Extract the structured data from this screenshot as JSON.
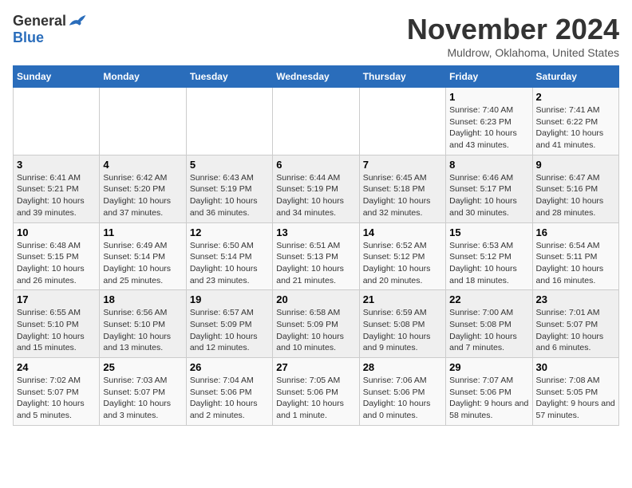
{
  "header": {
    "logo_general": "General",
    "logo_blue": "Blue",
    "month_title": "November 2024",
    "location": "Muldrow, Oklahoma, United States"
  },
  "weekdays": [
    "Sunday",
    "Monday",
    "Tuesday",
    "Wednesday",
    "Thursday",
    "Friday",
    "Saturday"
  ],
  "rows": [
    [
      {
        "day": "",
        "content": ""
      },
      {
        "day": "",
        "content": ""
      },
      {
        "day": "",
        "content": ""
      },
      {
        "day": "",
        "content": ""
      },
      {
        "day": "",
        "content": ""
      },
      {
        "day": "1",
        "content": "Sunrise: 7:40 AM\nSunset: 6:23 PM\nDaylight: 10 hours and 43 minutes."
      },
      {
        "day": "2",
        "content": "Sunrise: 7:41 AM\nSunset: 6:22 PM\nDaylight: 10 hours and 41 minutes."
      }
    ],
    [
      {
        "day": "3",
        "content": "Sunrise: 6:41 AM\nSunset: 5:21 PM\nDaylight: 10 hours and 39 minutes."
      },
      {
        "day": "4",
        "content": "Sunrise: 6:42 AM\nSunset: 5:20 PM\nDaylight: 10 hours and 37 minutes."
      },
      {
        "day": "5",
        "content": "Sunrise: 6:43 AM\nSunset: 5:19 PM\nDaylight: 10 hours and 36 minutes."
      },
      {
        "day": "6",
        "content": "Sunrise: 6:44 AM\nSunset: 5:19 PM\nDaylight: 10 hours and 34 minutes."
      },
      {
        "day": "7",
        "content": "Sunrise: 6:45 AM\nSunset: 5:18 PM\nDaylight: 10 hours and 32 minutes."
      },
      {
        "day": "8",
        "content": "Sunrise: 6:46 AM\nSunset: 5:17 PM\nDaylight: 10 hours and 30 minutes."
      },
      {
        "day": "9",
        "content": "Sunrise: 6:47 AM\nSunset: 5:16 PM\nDaylight: 10 hours and 28 minutes."
      }
    ],
    [
      {
        "day": "10",
        "content": "Sunrise: 6:48 AM\nSunset: 5:15 PM\nDaylight: 10 hours and 26 minutes."
      },
      {
        "day": "11",
        "content": "Sunrise: 6:49 AM\nSunset: 5:14 PM\nDaylight: 10 hours and 25 minutes."
      },
      {
        "day": "12",
        "content": "Sunrise: 6:50 AM\nSunset: 5:14 PM\nDaylight: 10 hours and 23 minutes."
      },
      {
        "day": "13",
        "content": "Sunrise: 6:51 AM\nSunset: 5:13 PM\nDaylight: 10 hours and 21 minutes."
      },
      {
        "day": "14",
        "content": "Sunrise: 6:52 AM\nSunset: 5:12 PM\nDaylight: 10 hours and 20 minutes."
      },
      {
        "day": "15",
        "content": "Sunrise: 6:53 AM\nSunset: 5:12 PM\nDaylight: 10 hours and 18 minutes."
      },
      {
        "day": "16",
        "content": "Sunrise: 6:54 AM\nSunset: 5:11 PM\nDaylight: 10 hours and 16 minutes."
      }
    ],
    [
      {
        "day": "17",
        "content": "Sunrise: 6:55 AM\nSunset: 5:10 PM\nDaylight: 10 hours and 15 minutes."
      },
      {
        "day": "18",
        "content": "Sunrise: 6:56 AM\nSunset: 5:10 PM\nDaylight: 10 hours and 13 minutes."
      },
      {
        "day": "19",
        "content": "Sunrise: 6:57 AM\nSunset: 5:09 PM\nDaylight: 10 hours and 12 minutes."
      },
      {
        "day": "20",
        "content": "Sunrise: 6:58 AM\nSunset: 5:09 PM\nDaylight: 10 hours and 10 minutes."
      },
      {
        "day": "21",
        "content": "Sunrise: 6:59 AM\nSunset: 5:08 PM\nDaylight: 10 hours and 9 minutes."
      },
      {
        "day": "22",
        "content": "Sunrise: 7:00 AM\nSunset: 5:08 PM\nDaylight: 10 hours and 7 minutes."
      },
      {
        "day": "23",
        "content": "Sunrise: 7:01 AM\nSunset: 5:07 PM\nDaylight: 10 hours and 6 minutes."
      }
    ],
    [
      {
        "day": "24",
        "content": "Sunrise: 7:02 AM\nSunset: 5:07 PM\nDaylight: 10 hours and 5 minutes."
      },
      {
        "day": "25",
        "content": "Sunrise: 7:03 AM\nSunset: 5:07 PM\nDaylight: 10 hours and 3 minutes."
      },
      {
        "day": "26",
        "content": "Sunrise: 7:04 AM\nSunset: 5:06 PM\nDaylight: 10 hours and 2 minutes."
      },
      {
        "day": "27",
        "content": "Sunrise: 7:05 AM\nSunset: 5:06 PM\nDaylight: 10 hours and 1 minute."
      },
      {
        "day": "28",
        "content": "Sunrise: 7:06 AM\nSunset: 5:06 PM\nDaylight: 10 hours and 0 minutes."
      },
      {
        "day": "29",
        "content": "Sunrise: 7:07 AM\nSunset: 5:06 PM\nDaylight: 9 hours and 58 minutes."
      },
      {
        "day": "30",
        "content": "Sunrise: 7:08 AM\nSunset: 5:05 PM\nDaylight: 9 hours and 57 minutes."
      }
    ]
  ]
}
